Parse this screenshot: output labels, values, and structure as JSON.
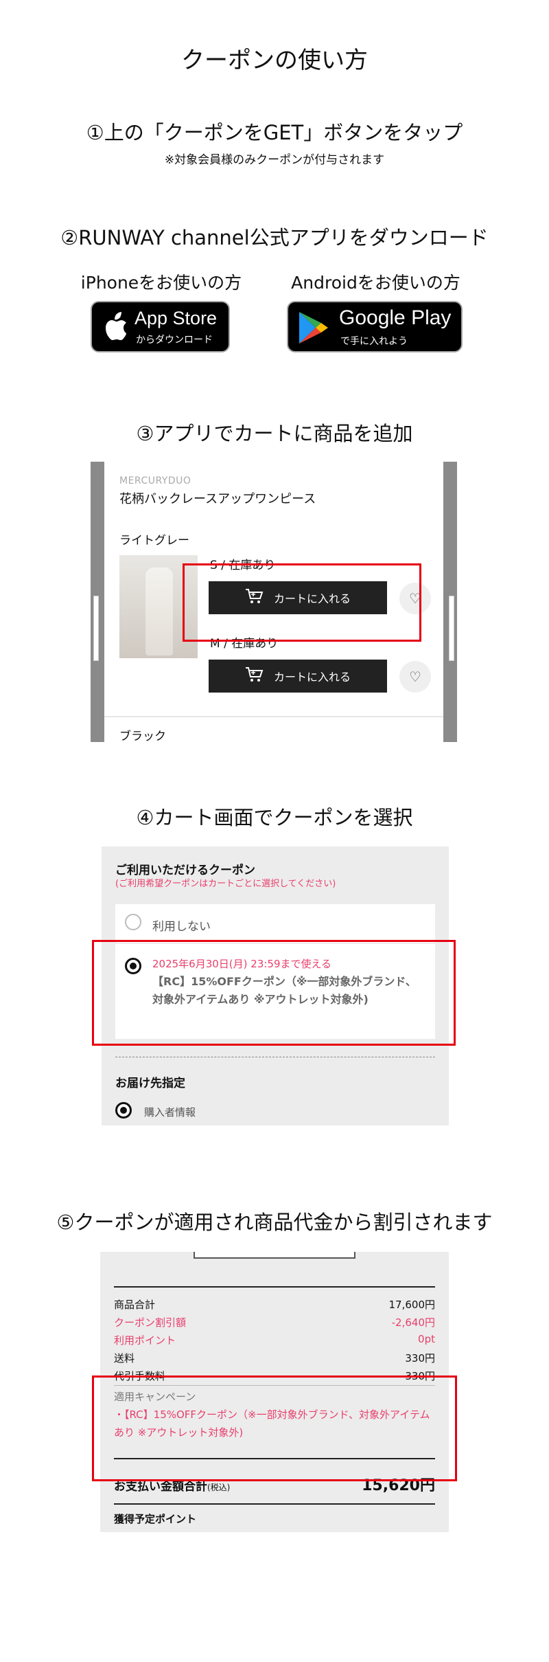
{
  "title": "クーポンの使い方",
  "step1": {
    "heading": "①上の「クーポンをGET」ボタンをタップ",
    "note": "※対象会員様のみクーポンが付与されます"
  },
  "step2": {
    "heading": "②RUNWAY channel公式アプリをダウンロード",
    "iphone_label": "iPhoneをお使いの方",
    "android_label": "Androidをお使いの方",
    "appstore": {
      "big": "App Store",
      "small": "からダウンロード",
      "icon": "apple-icon"
    },
    "googleplay": {
      "big": "Google Play",
      "small": "で手に入れよう",
      "icon": "google-play-icon"
    }
  },
  "step3": {
    "heading": "③アプリでカートに商品を追加",
    "brand": "MERCURYDUO",
    "product_name": "花柄バックレースアップワンピース",
    "color1": "ライトグレー",
    "sizes": [
      {
        "label": "S / 在庫あり",
        "button": "カートに入れる"
      },
      {
        "label": "M / 在庫あり",
        "button": "カートに入れる"
      }
    ],
    "color2": "ブラック"
  },
  "step4": {
    "heading": "④カート画面でクーポンを選択",
    "coupon_title": "ご利用いただけるクーポン",
    "coupon_sub": "(ご利用希望クーポンはカートごとに選択してください)",
    "no_use": "利用しない",
    "coupon_date": "2025年6月30日(月) 23:59まで使える",
    "coupon_name": "【RC】15%OFFクーポン（※一部対象外ブランド、対象外アイテムあり ※アウトレット対象外)",
    "shipping_title": "お届け先指定",
    "buyer": "購入者情報"
  },
  "step5": {
    "heading": "⑤クーポンが適用され商品代金から割引されます",
    "rows": [
      {
        "label": "商品合計",
        "value": "17,600円",
        "pink": false
      },
      {
        "label": "クーポン割引額",
        "value": "-2,640円",
        "pink": true
      },
      {
        "label": "利用ポイント",
        "value": "0pt",
        "pink": true
      },
      {
        "label": "送料",
        "value": "330円",
        "pink": false
      },
      {
        "label": "代引手数料",
        "value": "330円",
        "pink": false
      }
    ],
    "campaign_label": "適用キャンペーン",
    "campaign_item": "・【RC】15%OFFクーポン（※一部対象外ブランド、対象外アイテムあり ※アウトレット対象外)",
    "total_label": "お支払い金額合計",
    "total_tax": "(税込)",
    "total_value": "15,620円",
    "points_label": "獲得予定ポイント"
  }
}
